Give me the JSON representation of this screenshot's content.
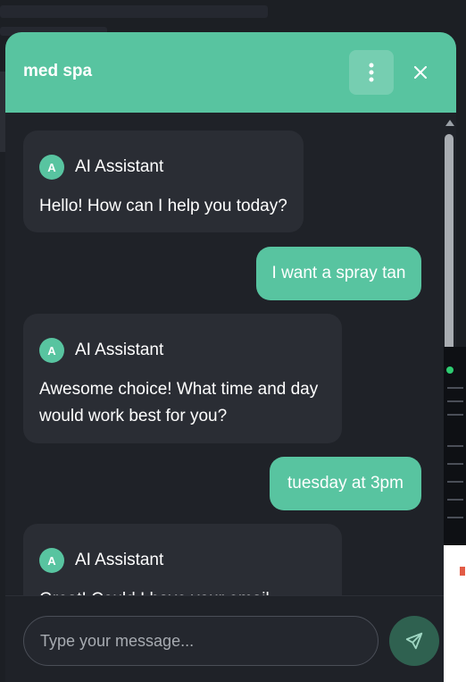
{
  "widget": {
    "title": "med spa",
    "input_placeholder": "Type your message...",
    "accent_color": "#58c4a0"
  },
  "messages": [
    {
      "role": "assistant",
      "sender": "AI Assistant",
      "avatar": "A",
      "text": "Hello! How can I help you today?"
    },
    {
      "role": "user",
      "text": "I want a spray tan"
    },
    {
      "role": "assistant",
      "sender": "AI Assistant",
      "avatar": "A",
      "text": "Awesome choice! What time and day would work best for you?"
    },
    {
      "role": "user",
      "text": "tuesday at 3pm"
    },
    {
      "role": "assistant",
      "sender": "AI Assistant",
      "avatar": "A",
      "text": "Great! Could I have your email..."
    }
  ],
  "icons": {
    "menu": "more-vertical-icon",
    "close": "close-icon",
    "send": "send-icon",
    "scroll": "chevron-up-icon"
  }
}
